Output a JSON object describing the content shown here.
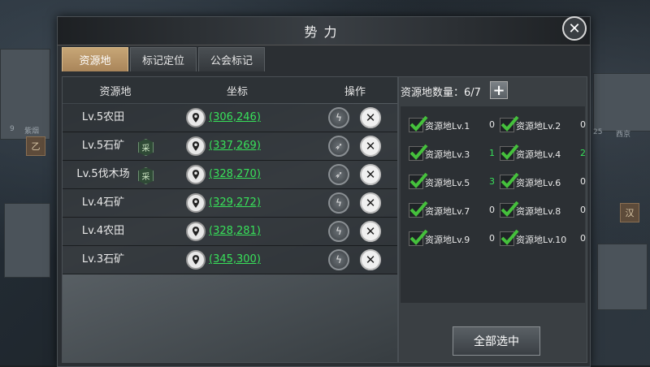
{
  "window": {
    "title": "势力",
    "close_icon": "close-icon"
  },
  "tabs": [
    {
      "label": "资源地",
      "active": true
    },
    {
      "label": "标记定位",
      "active": false
    },
    {
      "label": "公会标记",
      "active": false
    }
  ],
  "map": {
    "labels": [
      "9",
      "紫烟",
      "25",
      "西京"
    ],
    "badges": [
      "汉",
      "乙"
    ]
  },
  "list": {
    "headers": {
      "name": "资源地",
      "coords": "坐标",
      "ops": "操作"
    },
    "rows": [
      {
        "name": "Lv.5农田",
        "coords": "(306,246)",
        "collect": "",
        "op_icon": "boost-icon"
      },
      {
        "name": "Lv.5石矿",
        "coords": "(337,269)",
        "collect": "采",
        "op_icon": "speed-icon"
      },
      {
        "name": "Lv.5伐木场",
        "coords": "(328,270)",
        "collect": "采",
        "op_icon": "speed-icon"
      },
      {
        "name": "Lv.4石矿",
        "coords": "(329,272)",
        "collect": "",
        "op_icon": "boost-icon"
      },
      {
        "name": "Lv.4农田",
        "coords": "(328,281)",
        "collect": "",
        "op_icon": "boost-icon"
      },
      {
        "name": "Lv.3石矿",
        "coords": "(345,300)",
        "collect": "",
        "op_icon": "boost-icon"
      }
    ]
  },
  "filter": {
    "count_label": "资源地数量：6/7",
    "add_icon": "plus-icon",
    "items": [
      {
        "label": "资源地Lv.1",
        "count": "0",
        "checked": true
      },
      {
        "label": "资源地Lv.2",
        "count": "0",
        "checked": true
      },
      {
        "label": "资源地Lv.3",
        "count": "1",
        "checked": true
      },
      {
        "label": "资源地Lv.4",
        "count": "2",
        "checked": true
      },
      {
        "label": "资源地Lv.5",
        "count": "3",
        "checked": true
      },
      {
        "label": "资源地Lv.6",
        "count": "0",
        "checked": true
      },
      {
        "label": "资源地Lv.7",
        "count": "0",
        "checked": true
      },
      {
        "label": "资源地Lv.8",
        "count": "0",
        "checked": true
      },
      {
        "label": "资源地Lv.9",
        "count": "0",
        "checked": true
      },
      {
        "label": "资源地Lv.10",
        "count": "0",
        "checked": true
      }
    ],
    "select_all_label": "全部选中"
  },
  "colors": {
    "accent_green": "#38e05a",
    "tab_active": "#b8946a",
    "check_green": "#45c03c"
  }
}
